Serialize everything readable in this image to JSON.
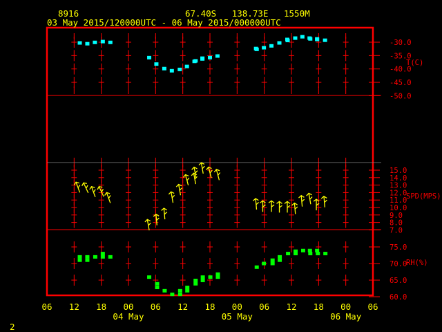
{
  "header": {
    "station": "8916",
    "location": "67.40S   138.73E   1550M",
    "period": "03 May 2015/120000UTC - 06 May 2015/000000UTC"
  },
  "footer_label": "2",
  "colors": {
    "frame": "#ff0000",
    "temperature": "#00ffff",
    "wind": "#ffff00",
    "rh": "#00ff00",
    "axis_text": "#ff0000",
    "time_text": "#ffff00"
  },
  "chart_data": [
    {
      "type": "scatter",
      "ylabel": "T(C)",
      "ylim": [
        -50,
        -27.5
      ],
      "yticks": [
        "-30.0",
        "-35.0",
        "-40.0",
        "-45.0",
        "-50.0"
      ],
      "xlim": [
        "03 06:00",
        "06 06:00"
      ],
      "points": [
        [
          "03 13:15",
          -30.4
        ],
        [
          "03 14:55",
          -30.7
        ],
        [
          "03 16:35",
          -30.2
        ],
        [
          "03 18:20",
          -29.9
        ],
        [
          "03 20:00",
          -30.2
        ],
        [
          "04 04:35",
          -35.9
        ],
        [
          "04 06:10",
          -38.3
        ],
        [
          "04 07:55",
          -40.0
        ],
        [
          "04 09:35",
          -40.8
        ],
        [
          "04 11:20",
          -40.3
        ],
        [
          "04 12:55",
          -39.2
        ],
        [
          "04 14:35",
          -37.3
        ],
        [
          "04 14:50",
          -37.1
        ],
        [
          "04 16:20",
          -36.4
        ],
        [
          "04 16:20",
          -36.1
        ],
        [
          "04 18:00",
          -35.9
        ],
        [
          "04 19:40",
          -35.3
        ],
        [
          "05 04:10",
          -32.5
        ],
        [
          "05 04:20",
          -32.8
        ],
        [
          "05 05:55",
          -32.2
        ],
        [
          "05 07:35",
          -31.5
        ],
        [
          "05 09:20",
          -30.4
        ],
        [
          "05 11:05",
          -29.1
        ],
        [
          "05 11:10",
          -29.5
        ],
        [
          "05 12:50",
          -28.6
        ],
        [
          "05 14:25",
          -28.1
        ],
        [
          "05 16:00",
          -28.6
        ],
        [
          "05 16:10",
          -28.9
        ],
        [
          "05 17:40",
          -28.9
        ],
        [
          "05 17:40",
          -29.1
        ],
        [
          "05 19:25",
          -29.4
        ]
      ]
    },
    {
      "type": "scatter",
      "ylabel": "SPD(MPS)",
      "ylim": [
        7,
        16.5
      ],
      "yticks": [
        "15.0",
        "14.0",
        "13.0",
        "12.0",
        "11.0",
        "10.0",
        "9.0",
        "8.0",
        "7.0"
      ],
      "xlim": [
        "03 06:00",
        "06 06:00"
      ],
      "marker": "wind-arrow",
      "points": [
        [
          "03 12:25",
          13.4,
          340
        ],
        [
          "03 14:05",
          13.3,
          335
        ],
        [
          "03 15:50",
          12.8,
          340
        ],
        [
          "03 17:30",
          12.8,
          335
        ],
        [
          "03 19:10",
          12.0,
          340
        ],
        [
          "04 04:10",
          8.4,
          350
        ],
        [
          "04 06:05",
          9.1,
          355
        ],
        [
          "04 07:50",
          9.9,
          355
        ],
        [
          "04 09:25",
          12.1,
          350
        ],
        [
          "04 11:05",
          13.1,
          350
        ],
        [
          "04 12:35",
          14.4,
          345
        ],
        [
          "04 14:25",
          14.6,
          350
        ],
        [
          "04 14:30",
          15.4,
          350
        ],
        [
          "04 16:05",
          16.0,
          350
        ],
        [
          "04 17:40",
          15.4,
          345
        ],
        [
          "04 19:25",
          15.1,
          345
        ],
        [
          "05 04:05",
          11.2,
          355
        ],
        [
          "05 05:40",
          10.9,
          0
        ],
        [
          "05 07:35",
          10.9,
          0
        ],
        [
          "05 09:20",
          10.8,
          0
        ],
        [
          "05 11:05",
          10.8,
          0
        ],
        [
          "05 12:40",
          10.6,
          355
        ],
        [
          "05 14:10",
          11.6,
          355
        ],
        [
          "05 15:50",
          11.9,
          350
        ],
        [
          "05 17:30",
          11.1,
          0
        ],
        [
          "05 19:10",
          11.5,
          355
        ]
      ]
    },
    {
      "type": "scatter",
      "ylabel": "RH(%)",
      "ylim": [
        60,
        80
      ],
      "yticks": [
        "75.0",
        "70.0",
        "65.0",
        "60.0"
      ],
      "xlim": [
        "03 06:00",
        "06 06:00"
      ],
      "points": [
        [
          "03 13:15",
          71.9
        ],
        [
          "03 13:15",
          70.9
        ],
        [
          "03 14:55",
          71.9
        ],
        [
          "03 14:55",
          70.9
        ],
        [
          "03 16:40",
          71.9
        ],
        [
          "03 18:20",
          72.9
        ],
        [
          "03 18:20",
          71.9
        ],
        [
          "03 20:00",
          71.9
        ],
        [
          "04 04:35",
          65.8
        ],
        [
          "04 06:20",
          63.8
        ],
        [
          "04 06:20",
          62.7
        ],
        [
          "04 08:00",
          61.7
        ],
        [
          "04 09:40",
          60.6
        ],
        [
          "04 11:25",
          61.7
        ],
        [
          "04 11:25",
          60.6
        ],
        [
          "04 13:00",
          62.7
        ],
        [
          "04 13:00",
          61.7
        ],
        [
          "04 14:50",
          64.8
        ],
        [
          "04 14:50",
          63.8
        ],
        [
          "04 16:25",
          65.8
        ],
        [
          "04 16:25",
          64.8
        ],
        [
          "04 18:05",
          65.8
        ],
        [
          "04 19:45",
          65.8
        ],
        [
          "04 19:45",
          66.7
        ],
        [
          "05 04:20",
          68.8
        ],
        [
          "05 05:55",
          69.9
        ],
        [
          "05 07:50",
          70.9
        ],
        [
          "05 07:50",
          69.9
        ],
        [
          "05 09:25",
          71.9
        ],
        [
          "05 09:25",
          70.9
        ],
        [
          "05 11:15",
          72.9
        ],
        [
          "05 12:55",
          73.6
        ],
        [
          "05 12:55",
          72.9
        ],
        [
          "05 14:35",
          73.8
        ],
        [
          "05 16:05",
          73.8
        ],
        [
          "05 16:10",
          72.9
        ],
        [
          "05 17:40",
          73.8
        ],
        [
          "05 17:50",
          72.9
        ],
        [
          "05 19:30",
          72.9
        ]
      ]
    }
  ],
  "x_axis": {
    "hour_ticks": [
      "06",
      "12",
      "18",
      "00",
      "06",
      "12",
      "18",
      "00",
      "06",
      "12",
      "18",
      "00",
      "06"
    ],
    "day_labels": [
      "04 May",
      "05 May",
      "06 May"
    ]
  }
}
